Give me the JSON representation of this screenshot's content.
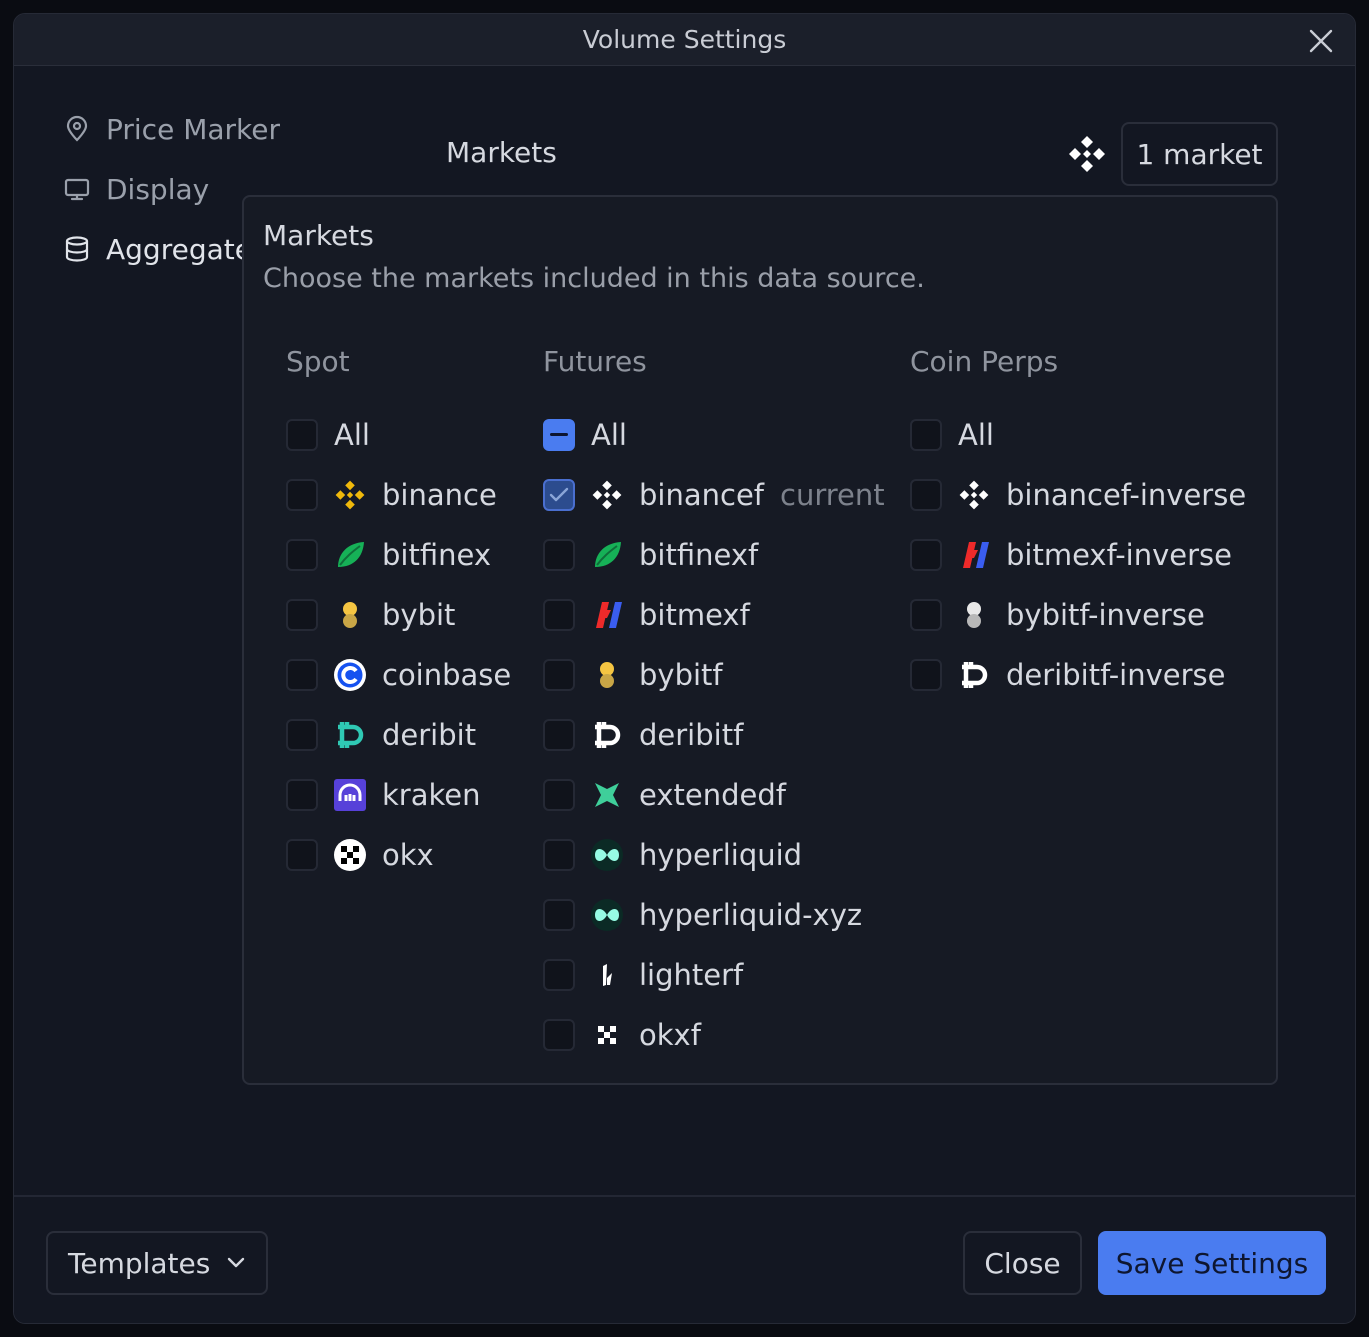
{
  "window": {
    "title": "Volume Settings"
  },
  "sidebar": {
    "items": [
      {
        "label": "Price Marker",
        "icon": "location-pin-icon"
      },
      {
        "label": "Display",
        "icon": "monitor-icon"
      },
      {
        "label": "Aggregate",
        "icon": "database-icon"
      }
    ]
  },
  "markets_row": {
    "label": "Markets",
    "button": "1 market",
    "icon": "binance-futures-logo"
  },
  "popover": {
    "title": "Markets",
    "description": "Choose the markets included in this data source.",
    "columns": {
      "spot": {
        "heading": "Spot",
        "all_label": "All",
        "all_state": "unchecked",
        "items": [
          {
            "name": "binance",
            "checked": false
          },
          {
            "name": "bitfinex",
            "checked": false
          },
          {
            "name": "bybit",
            "checked": false
          },
          {
            "name": "coinbase",
            "checked": false
          },
          {
            "name": "deribit",
            "checked": false
          },
          {
            "name": "kraken",
            "checked": false
          },
          {
            "name": "okx",
            "checked": false
          }
        ]
      },
      "futures": {
        "heading": "Futures",
        "all_label": "All",
        "all_state": "indeterminate",
        "items": [
          {
            "name": "binancef",
            "tag": "current",
            "checked": true
          },
          {
            "name": "bitfinexf",
            "checked": false
          },
          {
            "name": "bitmexf",
            "checked": false
          },
          {
            "name": "bybitf",
            "checked": false
          },
          {
            "name": "deribitf",
            "checked": false
          },
          {
            "name": "extendedf",
            "checked": false
          },
          {
            "name": "hyperliquid",
            "checked": false
          },
          {
            "name": "hyperliquid-xyz",
            "checked": false
          },
          {
            "name": "lighterf",
            "checked": false
          },
          {
            "name": "okxf",
            "checked": false
          }
        ]
      },
      "coin_perps": {
        "heading": "Coin Perps",
        "all_label": "All",
        "all_state": "unchecked",
        "items": [
          {
            "name": "binancef-inverse",
            "checked": false
          },
          {
            "name": "bitmexf-inverse",
            "checked": false
          },
          {
            "name": "bybitf-inverse",
            "checked": false
          },
          {
            "name": "deribitf-inverse",
            "checked": false
          }
        ]
      }
    }
  },
  "footer": {
    "templates_label": "Templates",
    "close_label": "Close",
    "save_label": "Save Settings"
  },
  "colors": {
    "background": "#131722",
    "accent": "#4a7cf0",
    "binance": "#f0b90b",
    "bitfinex": "#16b157",
    "kraken": "#5741d9",
    "coinbase": "#1652f0",
    "hyperliquid": "#97fce4"
  }
}
